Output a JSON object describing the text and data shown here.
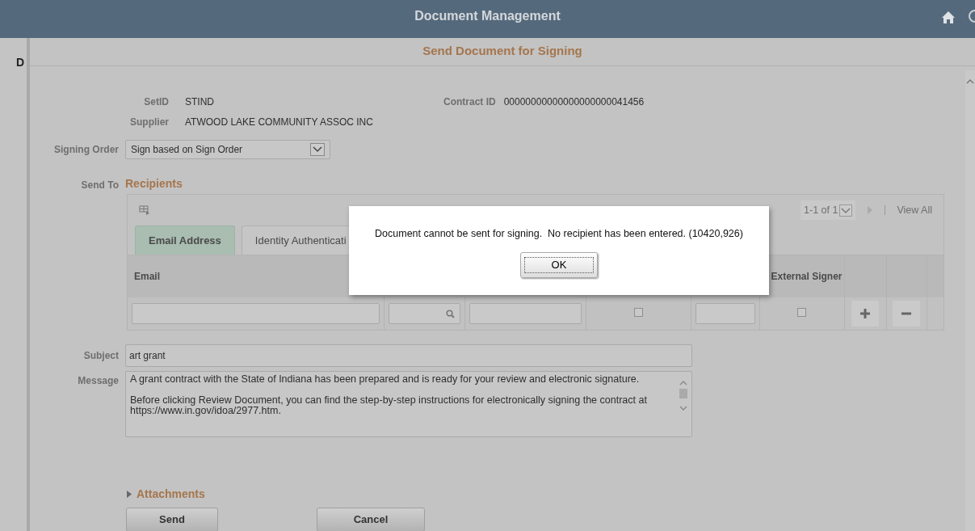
{
  "header": {
    "title": "Document Management"
  },
  "page_heading": "D",
  "modal": {
    "title": "Send Document for Signing"
  },
  "info": [
    {
      "label": "SetID",
      "value": "STIND"
    },
    {
      "label": "Contract ID",
      "value": "00000000000000000000041456"
    },
    {
      "label": "Supplier",
      "value": "ATWOOD LAKE COMMUNITY ASSOC INC"
    }
  ],
  "signing_order": {
    "label": "Signing Order",
    "value": "Sign based on Sign Order"
  },
  "send_to": {
    "label": "Send To",
    "title": "Recipients",
    "pager": "1-1 of 1",
    "view_all": "View All",
    "tabs": [
      {
        "label": "Email Address",
        "selected": true
      },
      {
        "label": "Identity Authenticati",
        "selected": false
      }
    ],
    "email_heading": "Email",
    "external_signer_heading": "External Signer",
    "row": [
      {
        "kind": "text"
      },
      {
        "kind": "lookup"
      },
      {
        "kind": "text"
      },
      {
        "kind": "checkbox",
        "checked": false
      },
      {
        "kind": "text"
      },
      {
        "kind": "checkbox",
        "checked": false
      },
      {
        "kind": "add"
      },
      {
        "kind": "remove"
      },
      {
        "kind": "blank"
      }
    ]
  },
  "subject": {
    "label": "Subject",
    "value": "art grant"
  },
  "message": {
    "label": "Message",
    "value": "A grant contract with the State of Indiana has been prepared and is ready for your review and electronic signature.\n\nBefore clicking Review Document, you can find the step-by-step instructions for electronically signing the contract at https://www.in.gov/idoa/2977.htm."
  },
  "attachments": "Attachments",
  "buttons": [
    "Send",
    "Cancel"
  ],
  "dialog": {
    "message": "Document cannot be sent for signing.  No recipient has been entered. (10420,926)",
    "button": "OK"
  }
}
